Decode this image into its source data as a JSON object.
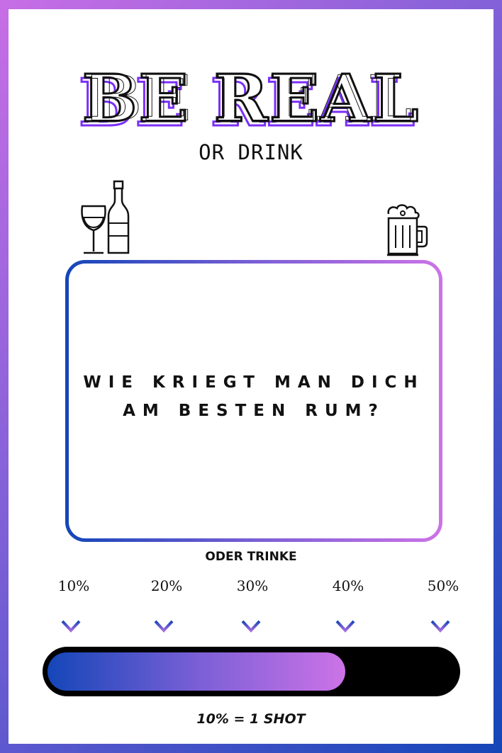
{
  "header": {
    "title": "BE REAL",
    "subtitle": "OR DRINK"
  },
  "card": {
    "question_line1": "WIE KRIEGT MAN DICH",
    "question_line2": "AM BESTEN RUM?"
  },
  "scale": {
    "label": "ODER TRINKE",
    "levels": [
      "10%",
      "20%",
      "30%",
      "40%",
      "50%"
    ],
    "progress_percent": 73
  },
  "footer": {
    "rule": "10% = 1 SHOT"
  },
  "colors": {
    "gradient_start": "#1446b8",
    "gradient_mid": "#7a5fd6",
    "gradient_end": "#cc73e6",
    "title_shadow": "#7b2ff7"
  },
  "icons": [
    "wine-glass-icon",
    "wine-bottle-icon",
    "beer-mug-icon",
    "arrow-down-icon"
  ]
}
